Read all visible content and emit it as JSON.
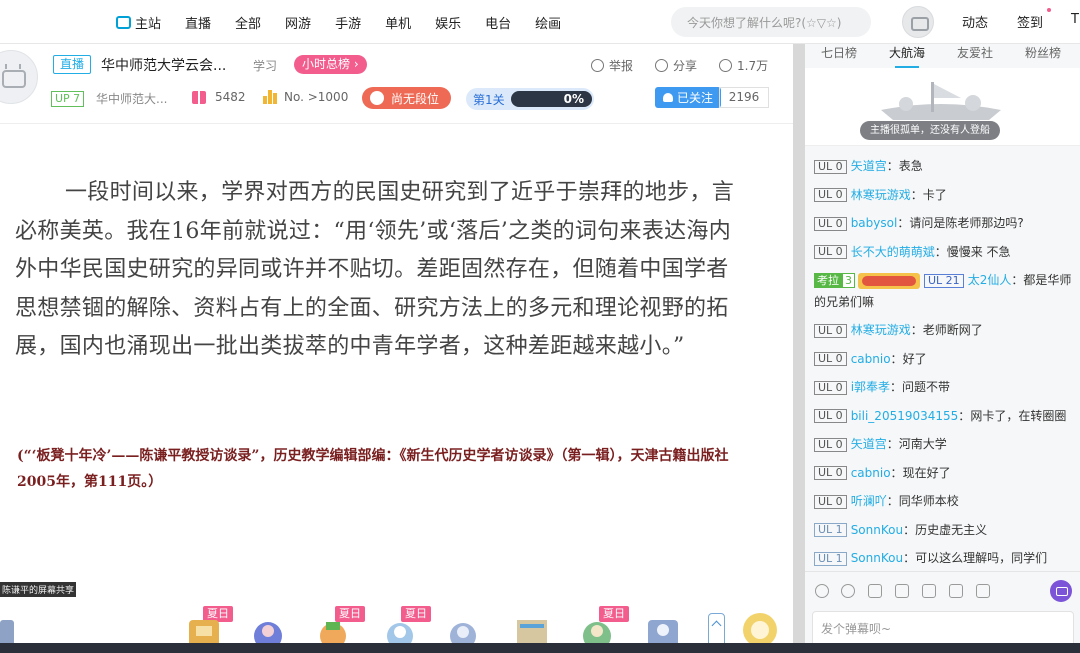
{
  "topnav": {
    "items": [
      "主站",
      "直播",
      "全部",
      "网游",
      "手游",
      "单机",
      "娱乐",
      "电台",
      "绘画"
    ],
    "search_placeholder": "今天你想了解什么呢?(☆▽☆)",
    "right_items": [
      "动态",
      "签到",
      "T"
    ],
    "accent": "#00a1d6"
  },
  "header": {
    "live_tag": "直播",
    "room_title": "华中师范大学云会...",
    "area": "学习",
    "rank_pill": "小时总榜 ›",
    "report": "举报",
    "share": "分享",
    "viewers": "1.7万",
    "up_tag": "UP 7",
    "up_name": "华中师范大...",
    "gifts": "5482",
    "rank_no": "No. >1000",
    "rank_btn": "尚无段位",
    "level_label": "第1关",
    "level_progress": 0,
    "level_pct": "0%",
    "follow_label": "已关注",
    "follow_count": "2196"
  },
  "video": {
    "paragraph": "一段时间以来，学界对西方的民国史研究到了近乎于崇拜的地步，言必称美英。我在16年前就说过：“用‘领先’或‘落后’之类的词句来表达海内外中华民国史研究的异同或许并不贴切。差距固然存在，但随着中国学者思想禁锢的解除、资料占有上的全面、研究方法上的多元和理论视野的拓展，国内也涌现出一批出类拔萃的中青年学者，这种差距越来越小。”",
    "citation": "(“‘板凳十年冷’——陈谦平教授访谈录”，历史教学编辑部编：《新生代历史学者访谈录》（第一辑），天津古籍出版社2005年，第111页。）",
    "owner_tag": "陈谦平的屏幕共享",
    "summer_tag": "夏日"
  },
  "sidebar": {
    "tabs": [
      "七日榜",
      "大航海",
      "友爱社",
      "粉丝榜"
    ],
    "active_tab": 1,
    "empty_text": "主播很孤单，还没有人登船",
    "input_placeholder": "发个弹幕呗~"
  },
  "chat": {
    "messages": [
      {
        "level": "UL 0",
        "user": "矢道宫",
        "text": "表急"
      },
      {
        "level": "UL 0",
        "user": "林寒玩游戏",
        "text": "卡了"
      },
      {
        "level": "UL 0",
        "user": "babysol",
        "text": "请问是陈老师那边吗?"
      },
      {
        "level": "UL 0",
        "user": "长不大的萌萌斌",
        "text": "慢慢来 不急"
      },
      {
        "badge": "考拉",
        "badge_level": "3",
        "level": "UL 21",
        "user": "太2仙人",
        "text": "都是华师的兄弟们嘛"
      },
      {
        "level": "UL 0",
        "user": "林寒玩游戏",
        "text": "老师断网了"
      },
      {
        "level": "UL 0",
        "user": "cabnio",
        "text": "好了"
      },
      {
        "level": "UL 0",
        "user": "i郭奉孝",
        "text": "问题不带"
      },
      {
        "level": "UL 0",
        "user": "bili_20519034155",
        "text": "网卡了，在转圈圈"
      },
      {
        "level": "UL 0",
        "user": "矢道宫",
        "text": "河南大学"
      },
      {
        "level": "UL 0",
        "user": "cabnio",
        "text": "现在好了"
      },
      {
        "level": "UL 0",
        "user": "听澜吖",
        "text": "同华师本校"
      },
      {
        "level": "UL 1",
        "user": "SonnKou",
        "text": "历史虚无主义"
      },
      {
        "level": "UL 1",
        "user": "SonnKou",
        "text": "可以这么理解吗，同学们"
      }
    ]
  }
}
